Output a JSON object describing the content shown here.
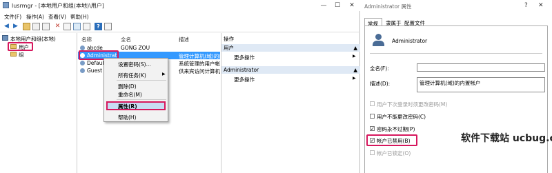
{
  "window": {
    "title": "lusrmgr - [本地用户和组(本地)\\用户]",
    "controls": [
      "—",
      "☐",
      "✕"
    ]
  },
  "menu": [
    "文件(F)",
    "操作(A)",
    "查看(V)",
    "帮助(H)"
  ],
  "tree": {
    "root": "本地用户和组(本地)",
    "users": "用户",
    "groups": "组"
  },
  "list": {
    "headers": [
      "名称",
      "全名",
      "描述"
    ],
    "rows": [
      {
        "name": "abcde",
        "fullname": "GONG ZOU",
        "desc": ""
      },
      {
        "name": "Administrat",
        "fullname": "",
        "desc": "管理计算机(域)的内"
      },
      {
        "name": "Default",
        "fullname": "",
        "desc": "系统管理的用户帐"
      },
      {
        "name": "Guest",
        "fullname": "",
        "desc": "供来宾访问计算机"
      }
    ]
  },
  "actions": {
    "header": "操作",
    "sections": [
      {
        "title": "用户",
        "item": "更多操作"
      },
      {
        "title": "Administrator",
        "item": "更多操作"
      }
    ]
  },
  "context_menu": [
    "设置密码(S)...",
    "所有任务(K)",
    "删除(D)",
    "重命名(M)",
    "属性(R)",
    "帮助(H)"
  ],
  "dialog": {
    "title": "Administrator 属性",
    "tabs": [
      "常规",
      "隶属于",
      "配置文件"
    ],
    "username": "Administrator",
    "fullname_label": "全名(F):",
    "fullname_value": "",
    "desc_label": "描述(D):",
    "desc_value": "管理计算机(域)的内置帐户",
    "options": [
      {
        "label": "用户下次登录时须更改密码(M)",
        "checked": false,
        "disabled": true
      },
      {
        "label": "用户不能更改密码(C)",
        "checked": false,
        "disabled": false
      },
      {
        "label": "密码永不过期(P)",
        "checked": true,
        "disabled": false
      },
      {
        "label": "帐户已禁用(B)",
        "checked": true,
        "disabled": false
      },
      {
        "label": "帐户已锁定(O)",
        "checked": false,
        "disabled": true
      }
    ]
  },
  "watermark": "软件下载站 ucbug.cc",
  "colors": {
    "highlight": "#d6175d",
    "selected": "#3399ff",
    "header_blue": "#dfe9f5"
  }
}
